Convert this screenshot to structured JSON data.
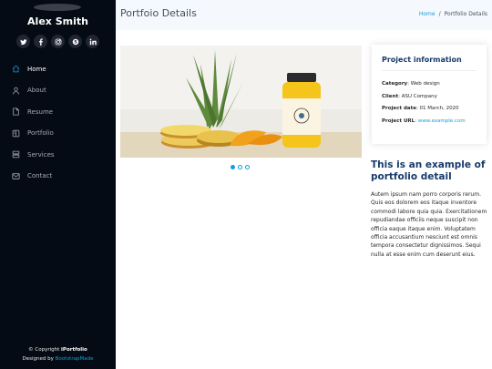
{
  "profile": {
    "name": "Alex Smith"
  },
  "socials": [
    {
      "icon": "twitter-icon"
    },
    {
      "icon": "facebook-icon"
    },
    {
      "icon": "instagram-icon"
    },
    {
      "icon": "skype-icon"
    },
    {
      "icon": "linkedin-icon"
    }
  ],
  "nav": {
    "items": [
      {
        "label": "Home",
        "icon": "home-icon",
        "active": true
      },
      {
        "label": "About",
        "icon": "person-icon"
      },
      {
        "label": "Resume",
        "icon": "file-icon"
      },
      {
        "label": "Portfolio",
        "icon": "book-icon"
      },
      {
        "label": "Services",
        "icon": "server-icon"
      },
      {
        "label": "Contact",
        "icon": "envelope-icon"
      }
    ]
  },
  "footer": {
    "copyright_prefix": "© Copyright ",
    "brand": "iPortfolio",
    "designed_prefix": "Designed by ",
    "designer": "BootstrapMade"
  },
  "header": {
    "title": "Portfoio Details",
    "breadcrumb": {
      "home": "Home",
      "separator": "/",
      "current": "Portfolio Details"
    }
  },
  "slider": {
    "dot_count": 3,
    "active_index": 0
  },
  "project_info": {
    "title": "Project information",
    "category_label": "Category",
    "category": ": Web design",
    "client_label": "Client",
    "client": ": ASU Company",
    "date_label": "Project date",
    "date": ": 01 March, 2020",
    "url_label": "Project URL",
    "url_sep": ": ",
    "url": "www.example.com"
  },
  "description": {
    "title": "This is an example of portfolio detail",
    "text": "Autem ipsum nam porro corporis rerum. Quis eos dolorem eos itaque inventore commodi labore quia quia. Exercitationem repudiandae officiis neque suscipit non officia eaque itaque enim. Voluptatem officia accusantium nesciunt est omnis tempora consectetur dignissimos. Sequi nulla at esse enim cum deserunt eius."
  },
  "colors": {
    "accent": "#149ddd",
    "sidebar_bg": "#040b14",
    "heading": "#173b6c"
  }
}
